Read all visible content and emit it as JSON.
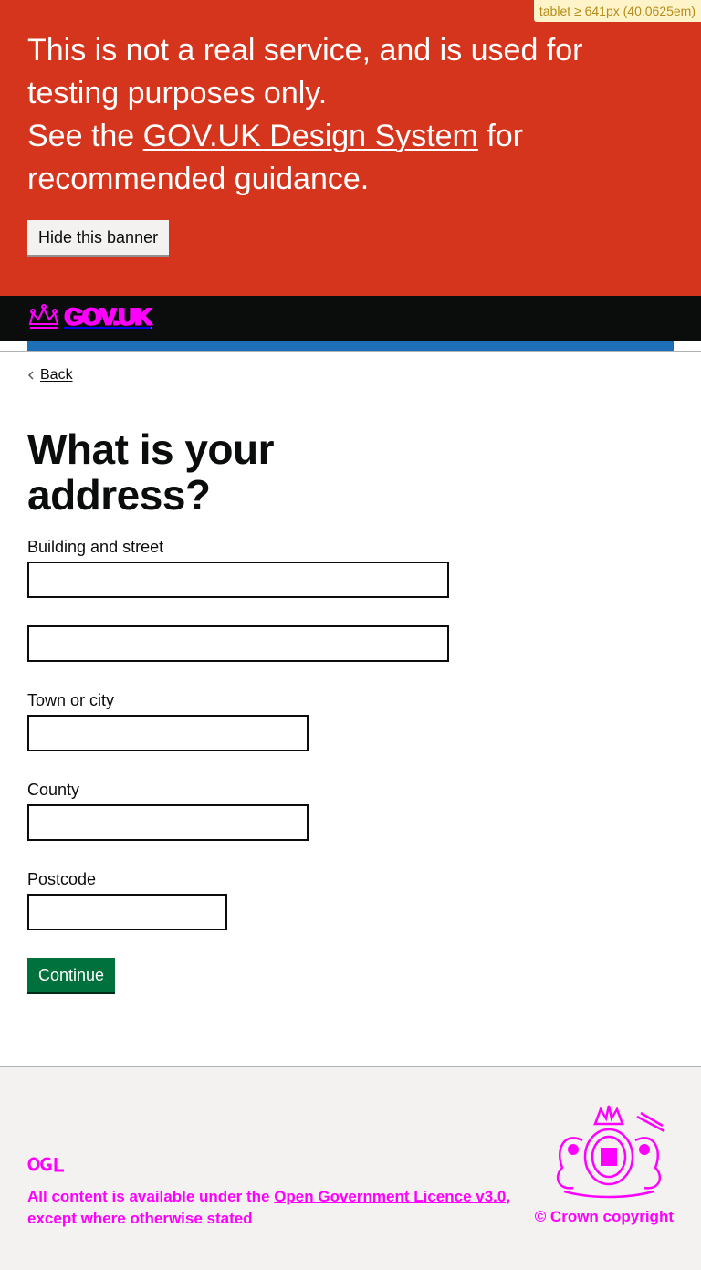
{
  "breakpoint_badge": "tablet ≥ 641px (40.0625em)",
  "banner": {
    "line1": "This is not a real service, and is used for testing purposes only.",
    "line2_before": "See the ",
    "line2_link": "GOV.UK Design System",
    "line2_after": " for recommended guidance.",
    "hide_button": "Hide this banner"
  },
  "header": {
    "logo_text": "GOV.UK",
    "logo_icon": "crown-icon"
  },
  "back_link": "Back",
  "page_title": "What is your address?",
  "form": {
    "building_label": "Building and street",
    "building_line1_value": "",
    "building_line2_value": "",
    "town_label": "Town or city",
    "town_value": "",
    "county_label": "County",
    "county_value": "",
    "postcode_label": "Postcode",
    "postcode_value": "",
    "continue_button": "Continue"
  },
  "footer": {
    "ogl_logo": "OGL",
    "licence_before": "All content is available under the ",
    "licence_link": "Open Government Licence v3.0",
    "licence_after": ", except where otherwise stated",
    "copyright": "© Crown copyright",
    "crest_icon": "royal-crest-icon"
  },
  "colors": {
    "banner_red": "#d4351c",
    "header_black": "#0b0c0c",
    "header_blue": "#1d70b8",
    "button_green": "#00703c",
    "footer_grey": "#f3f2f1",
    "placeholder_magenta": "#ff00ff"
  }
}
